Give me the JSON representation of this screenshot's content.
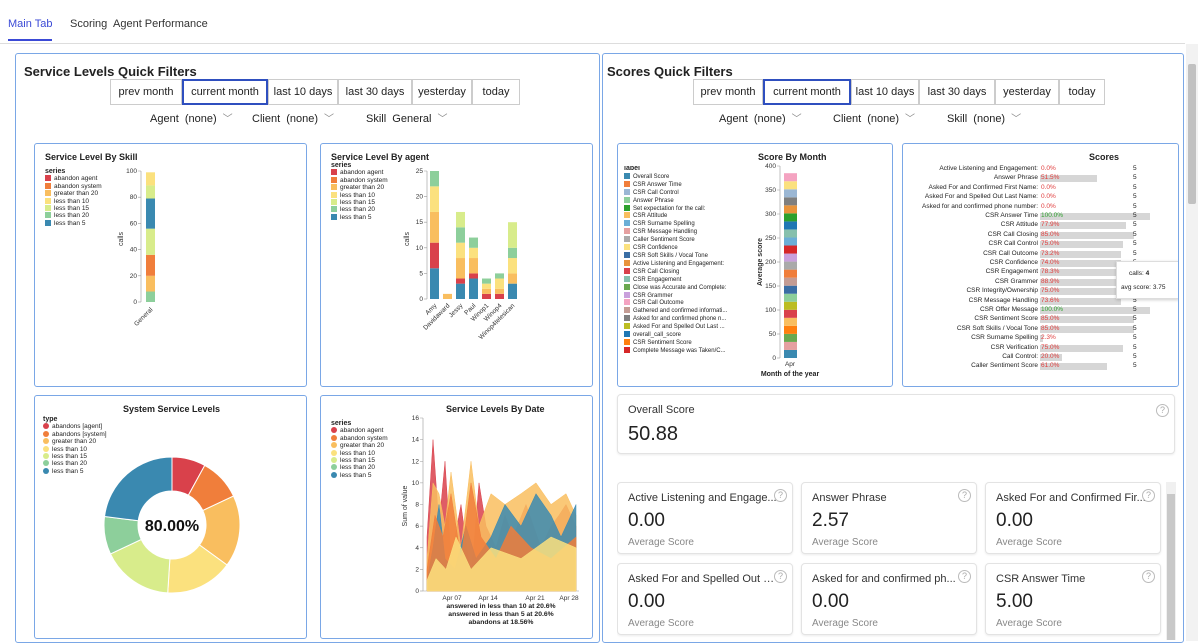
{
  "tabs": [
    "Main Tab",
    "Scoring",
    "Agent Performance"
  ],
  "service_levels": {
    "title": "Service Levels Quick Filters",
    "buttons": [
      "prev month",
      "current month",
      "last 10 days",
      "last 30 days",
      "yesterday",
      "today"
    ],
    "filters": {
      "agent_label": "Agent",
      "agent_value": "(none)",
      "client_label": "Client",
      "client_value": "(none)",
      "skill_label": "Skill",
      "skill_value": "General"
    }
  },
  "scores": {
    "title": "Scores Quick Filters",
    "buttons": [
      "prev month",
      "current month",
      "last 10 days",
      "last 30 days",
      "yesterday",
      "today"
    ],
    "filters": {
      "agent_label": "Agent",
      "agent_value": "(none)",
      "client_label": "Client",
      "client_value": "(none)",
      "skill_label": "Skill",
      "skill_value": "(none)"
    }
  },
  "colors": {
    "abandon agent": "#d9414b",
    "abandon system": "#f07e3b",
    "greater than 20": "#f9be5f",
    "less than 10": "#fbe17e",
    "less than 15": "#d8ec8b",
    "less than 20": "#8dcf9b",
    "less than 5": "#3a89b0"
  },
  "series_names": [
    "abandon agent",
    "abandon system",
    "greater than 20",
    "less than 10",
    "less than 15",
    "less than 20",
    "less than 5"
  ],
  "chart_data": [
    {
      "type": "bar",
      "title": "Service Level By Skill",
      "legend_title": "series",
      "ylabel": "calls",
      "ylim": [
        0,
        100
      ],
      "yticks": [
        "100",
        "80",
        "60",
        "40",
        "20",
        "0"
      ],
      "categories": [
        "General"
      ],
      "series": [
        {
          "name": "less than 20",
          "values": [
            8
          ]
        },
        {
          "name": "greater than 20",
          "values": [
            12
          ]
        },
        {
          "name": "abandon system",
          "values": [
            16
          ]
        },
        {
          "name": "less than 15",
          "values": [
            20
          ]
        },
        {
          "name": "less than 5",
          "values": [
            23
          ]
        },
        {
          "name": "less than 15",
          "values": [
            10
          ]
        },
        {
          "name": "less than 10",
          "values": [
            10
          ]
        }
      ]
    },
    {
      "type": "bar",
      "title": "Service Level By agent",
      "legend_title": "series",
      "ylabel": "calls",
      "ylim": [
        0,
        25
      ],
      "yticks": [
        "25",
        "20",
        "15",
        "10",
        "5",
        "0"
      ],
      "categories": [
        "Amy",
        "Davidaward",
        "Jessy",
        "Paul",
        "Winop1",
        "Winop4",
        "Winop4telesican"
      ],
      "series": [
        {
          "name": "less than 5",
          "values": [
            6,
            0,
            3,
            4,
            0,
            0,
            3
          ]
        },
        {
          "name": "abandon agent",
          "values": [
            5,
            0,
            1,
            1,
            1,
            1,
            0
          ]
        },
        {
          "name": "greater than 20",
          "values": [
            6,
            1,
            4,
            3,
            1,
            1,
            2
          ]
        },
        {
          "name": "less than 10",
          "values": [
            5,
            0,
            3,
            2,
            1,
            2,
            3
          ]
        },
        {
          "name": "less than 20",
          "values": [
            3,
            0,
            3,
            2,
            1,
            1,
            2
          ]
        },
        {
          "name": "less than 15",
          "values": [
            0,
            0,
            3,
            0,
            0,
            0,
            5
          ]
        }
      ]
    },
    {
      "type": "pie",
      "title": "System Service Levels",
      "legend_title": "type",
      "center_label": "80.00%",
      "legend": [
        "abandons [agent]",
        "abandons [system]",
        "greater than 20",
        "less than 10",
        "less than 15",
        "less than 20",
        "less than 5"
      ],
      "values": [
        8,
        10,
        17,
        16,
        17,
        9,
        23
      ]
    },
    {
      "type": "area",
      "title": "Service Levels By Date",
      "legend_title": "series",
      "ylabel": "Sum of value",
      "ylim": [
        0,
        16
      ],
      "yticks": [
        "16",
        "14",
        "12",
        "10",
        "8",
        "6",
        "4",
        "2",
        "0"
      ],
      "xticks": [
        "Apr 07",
        "Apr 14",
        "Apr 21",
        "Apr 28"
      ],
      "notes": [
        "answered in less than 10 at 20.6%",
        "answered in less than 5 at 20.6%",
        "abandons at 18.56%"
      ]
    },
    {
      "type": "bar",
      "title": "Score By Month",
      "legend_title": "label",
      "ylabel": "Average score",
      "xlabel": "Month of the year",
      "ylim": [
        0,
        400
      ],
      "yticks": [
        "400",
        "350",
        "300",
        "250",
        "200",
        "150",
        "100",
        "50",
        "0"
      ],
      "categories": [
        "Apr"
      ],
      "legend": [
        "Overall Score",
        "CSR Answer Time",
        "CSR Call Control",
        "Answer Phrase",
        "Set expectation for the call:",
        "CSR Attitude",
        "CSR Surname Spelling",
        "CSR Message Handling",
        "Caller Sentiment Score",
        "CSR Confidence",
        "CSR Soft Skills / Vocal Tone",
        "Active Listening and Engagement:",
        "CSR Call Closing",
        "CSR Engagement",
        "Close was Accurate and Complete:",
        "CSR Grammer",
        "CSR Call Outcome",
        "Gathered and confirmed informati...",
        "Asked for and confirmed phone n...",
        "Asked For and Spelled Out Last ...",
        "overall_call_score",
        "CSR Sentiment Score",
        "Complete Message was Taken/C..."
      ],
      "total": 385
    },
    {
      "type": "bar",
      "title": "Scores",
      "rows": [
        {
          "label": "Active Listening and Engagement:",
          "pct": "0.0%",
          "v": 0,
          "score": "5"
        },
        {
          "label": "Answer Phrase",
          "pct": "51.5%",
          "v": 51.5,
          "score": "5"
        },
        {
          "label": "Asked For and Confirmed First Name:",
          "pct": "0.0%",
          "v": 0,
          "score": "5"
        },
        {
          "label": "Asked For and Spelled Out Last Name:",
          "pct": "0.0%",
          "v": 0,
          "score": "5"
        },
        {
          "label": "Asked for and confirmed phone number:",
          "pct": "0.0%",
          "v": 0,
          "score": "5"
        },
        {
          "label": "CSR Answer Time",
          "pct": "100.0%",
          "v": 100,
          "score": "5"
        },
        {
          "label": "CSR Attitude",
          "pct": "77.9%",
          "v": 77.9,
          "score": "5"
        },
        {
          "label": "CSR Call Closing",
          "pct": "85.0%",
          "v": 85,
          "score": "5"
        },
        {
          "label": "CSR Call Control",
          "pct": "75.0%",
          "v": 75,
          "score": "5"
        },
        {
          "label": "CSR Call Outcome",
          "pct": "73.2%",
          "v": 73.2,
          "score": "5"
        },
        {
          "label": "CSR Confidence",
          "pct": "74.0%",
          "v": 74,
          "score": "5"
        },
        {
          "label": "CSR Engagement",
          "pct": "78.3%",
          "v": 78.3,
          "score": "5"
        },
        {
          "label": "CSR Grammer",
          "pct": "88.9%",
          "v": 88.9,
          "score": "5"
        },
        {
          "label": "CSR Integrity/Ownership",
          "pct": "75.0%",
          "v": 75,
          "score": "5"
        },
        {
          "label": "CSR Message Handling",
          "pct": "73.6%",
          "v": 73.6,
          "score": "5"
        },
        {
          "label": "CSR Offer Message",
          "pct": "100.0%",
          "v": 100,
          "score": "5"
        },
        {
          "label": "CSR Sentiment Score",
          "pct": "85.0%",
          "v": 85,
          "score": "5"
        },
        {
          "label": "CSR Soft Skills / Vocal Tone",
          "pct": "85.0%",
          "v": 85,
          "score": "5"
        },
        {
          "label": "CSR Surname Spelling",
          "pct": "2.3%",
          "v": 2.3,
          "score": "5"
        },
        {
          "label": "CSR Verification",
          "pct": "75.0%",
          "v": 75,
          "score": "5"
        },
        {
          "label": "Call Control:",
          "pct": "20.0%",
          "v": 20,
          "score": "5"
        },
        {
          "label": "Caller Sentiment Score",
          "pct": "61.0%",
          "v": 61,
          "score": "5"
        }
      ]
    }
  ],
  "tooltip": {
    "calls_label": "calls:",
    "calls_value": "4",
    "avg_label": "avg score:",
    "avg_value": "3.75"
  },
  "overall": {
    "title": "Overall Score",
    "value": "50.88"
  },
  "kpis": [
    {
      "title": "Active Listening and Engage...",
      "value": "0.00",
      "sub": "Average Score"
    },
    {
      "title": "Answer Phrase",
      "value": "2.57",
      "sub": "Average Score"
    },
    {
      "title": "Asked For and Confirmed Fir...",
      "value": "0.00",
      "sub": "Average Score"
    },
    {
      "title": "Asked For and Spelled Out L...",
      "value": "0.00",
      "sub": "Average Score"
    },
    {
      "title": "Asked for and confirmed ph...",
      "value": "0.00",
      "sub": "Average Score"
    },
    {
      "title": "CSR Answer Time",
      "value": "5.00",
      "sub": "Average Score"
    }
  ]
}
